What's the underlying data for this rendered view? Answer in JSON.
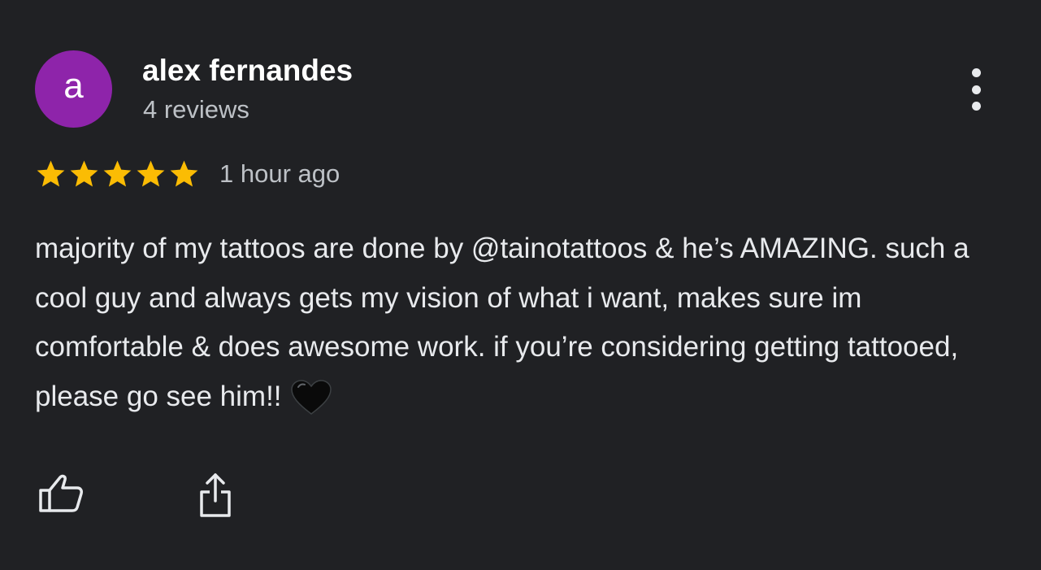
{
  "review": {
    "avatar_letter": "a",
    "avatar_color": "#8e24aa",
    "author_name": "alex fernandes",
    "review_count": "4 reviews",
    "rating": 5,
    "rating_max": 5,
    "star_color": "#fbbc04",
    "time_ago": "1 hour ago",
    "text": "majority of my tattoos are done by @tainotattoos & he’s AMAZING. such a cool guy and always gets my vision of what i want, makes sure im comfortable & does awesome work. if you’re considering getting tattooed, please go see him!!",
    "emoji": "black-heart-icon"
  },
  "actions": {
    "menu_icon": "more-vert-icon",
    "like_icon": "thumbs-up-icon",
    "share_icon": "share-icon"
  }
}
